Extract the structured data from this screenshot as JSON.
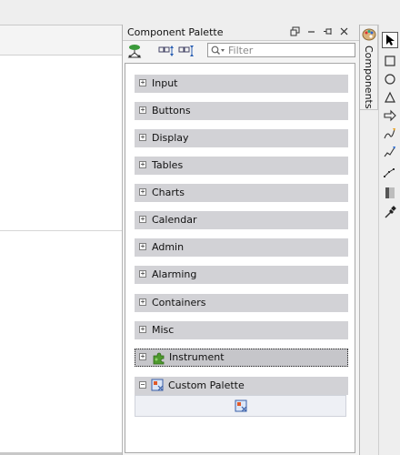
{
  "panel": {
    "title": "Component Palette",
    "filter_placeholder": "Filter"
  },
  "categories": [
    {
      "label": "Input",
      "expanded": false
    },
    {
      "label": "Buttons",
      "expanded": false
    },
    {
      "label": "Display",
      "expanded": false
    },
    {
      "label": "Tables",
      "expanded": false
    },
    {
      "label": "Charts",
      "expanded": false
    },
    {
      "label": "Calendar",
      "expanded": false
    },
    {
      "label": "Admin",
      "expanded": false
    },
    {
      "label": "Alarming",
      "expanded": false
    },
    {
      "label": "Containers",
      "expanded": false
    },
    {
      "label": "Misc",
      "expanded": false
    },
    {
      "label": "Instrument",
      "expanded": false,
      "selected": true,
      "icon": "puzzle-icon"
    },
    {
      "label": "Custom Palette",
      "expanded": true,
      "icon": "custom-palette-icon"
    }
  ],
  "side_tab": {
    "label": "Components",
    "icon": "palette-icon"
  },
  "tools": [
    "pointer-icon",
    "rectangle-icon",
    "ellipse-icon",
    "triangle-icon",
    "arrow-icon",
    "pen-icon",
    "pencil-icon",
    "path-icon",
    "gradient-icon",
    "eyedropper-icon"
  ],
  "colors": {
    "category_header": "#d2d2d6",
    "panel_bg": "#f4f4f4",
    "selected_outline": "#222222"
  }
}
